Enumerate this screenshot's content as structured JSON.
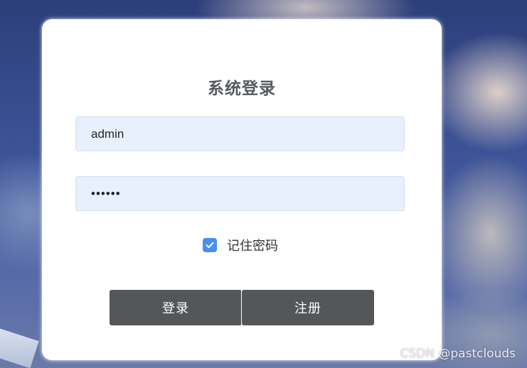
{
  "login": {
    "title": "系统登录",
    "username_value": "admin",
    "password_value": "••••••",
    "remember_label": "记住密码",
    "remember_checked": true,
    "login_button": "登录",
    "register_button": "注册"
  },
  "colors": {
    "button_bg": "#545659",
    "input_bg": "#e8f0fe",
    "checkbox_accent": "#4a8ef3"
  },
  "watermark": "CSDN @pastclouds"
}
